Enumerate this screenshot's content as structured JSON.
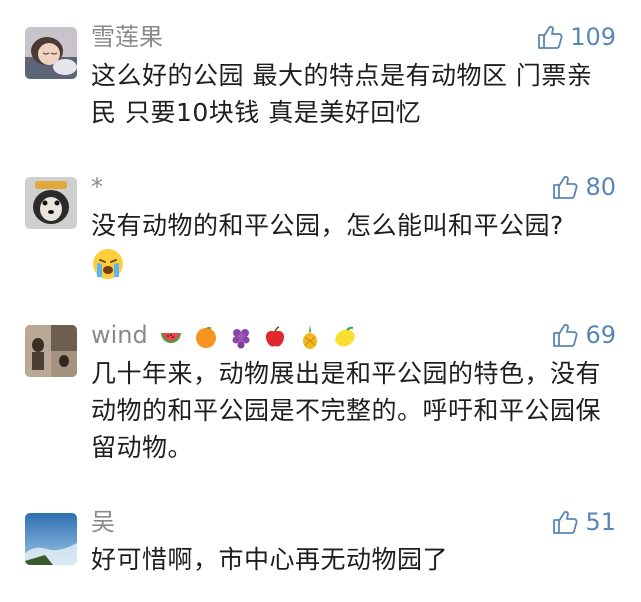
{
  "comments": [
    {
      "username": "雪莲果",
      "like_count": "109",
      "text": "这么好的公园 最大的特点是有动物区 门票亲民 只要10块钱 真是美好回忆",
      "avatar": "sleeping-girl-avatar"
    },
    {
      "username": "*",
      "like_count": "80",
      "text": "没有动物的和平公园，怎么能叫和平公园?",
      "inline_emoji": "crying-face-emoji",
      "avatar": "dog-avatar"
    },
    {
      "username": "wind",
      "username_emojis": [
        "watermelon-emoji",
        "tangerine-emoji",
        "grapes-emoji",
        "red-apple-emoji",
        "pineapple-emoji",
        "lemon-emoji"
      ],
      "like_count": "69",
      "text": "几十年来，动物展出是和平公园的特色，没有动物的和平公园是不完整的。呼吁和平公园保留动物。",
      "avatar": "photo-collage-avatar"
    },
    {
      "username": "吴",
      "like_count": "51",
      "text": "好可惜啊，市中心再无动物园了",
      "avatar": "sky-avatar"
    }
  ],
  "colors": {
    "username": "#8a8a8a",
    "like": "#5a86b3",
    "text": "#1e1e1e",
    "background": "#ffffff"
  },
  "icons": {
    "like": "thumbs-up-icon"
  }
}
